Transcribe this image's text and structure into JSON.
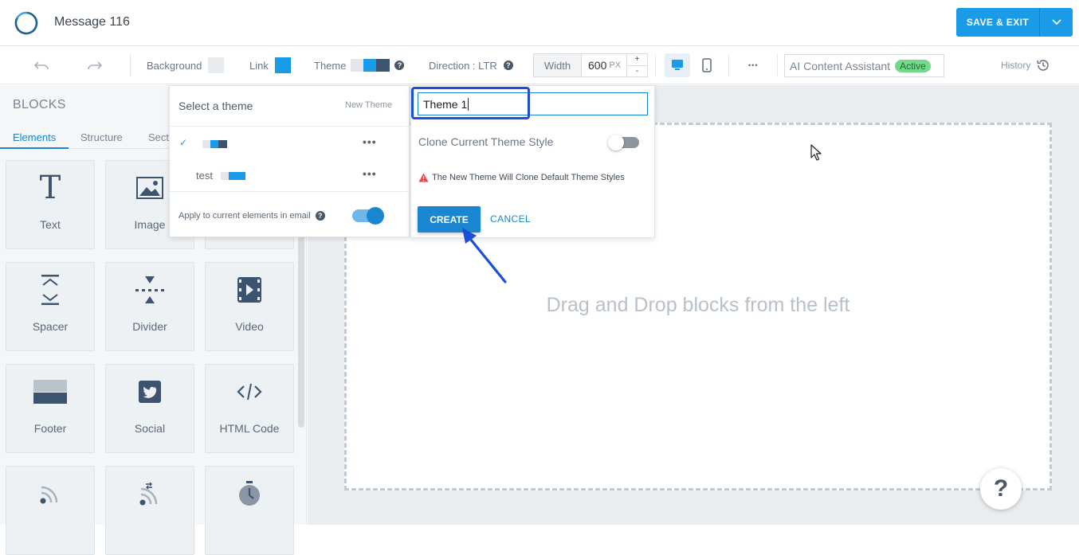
{
  "header": {
    "title": "Message 116",
    "save_label": "SAVE & EXIT"
  },
  "toolbar": {
    "background_label": "Background",
    "link_label": "Link",
    "theme_label": "Theme",
    "direction_label": "Direction : LTR",
    "width_label": "Width",
    "width_value": "600",
    "width_unit": "PX",
    "plus": "+",
    "minus": "-",
    "more": "•••",
    "ai_label": "AI Content Assistant",
    "ai_status": "Active",
    "history_label": "History",
    "help_glyph": "?",
    "background_color": "#e9ecef",
    "link_color": "#1a9be7"
  },
  "sidebar": {
    "title": "BLOCKS",
    "tabs": [
      "Elements",
      "Structure",
      "Sect"
    ],
    "tiles": [
      {
        "label": "Text",
        "icon": "text-icon"
      },
      {
        "label": "Image",
        "icon": "image-icon"
      },
      {
        "label": "Spacer",
        "icon": "spacer-icon"
      },
      {
        "label": "Divider",
        "icon": "divider-icon"
      },
      {
        "label": "Video",
        "icon": "video-icon"
      },
      {
        "label": "Footer",
        "icon": "footer-icon"
      },
      {
        "label": "Social",
        "icon": "twitter-icon"
      },
      {
        "label": "HTML Code",
        "icon": "code-icon"
      },
      {
        "label": "",
        "icon": "rss-icon"
      },
      {
        "label": "",
        "icon": "rss-refresh-icon"
      },
      {
        "label": "",
        "icon": "timer-icon"
      }
    ]
  },
  "theme_popover": {
    "title": "Select a theme",
    "new_theme": "New Theme",
    "themes": [
      {
        "name": "",
        "selected": true,
        "check": "✓"
      },
      {
        "name": "test",
        "selected": false,
        "check": ""
      }
    ],
    "row_menu": "•••",
    "apply_label": "Apply to current elements in email",
    "apply_enabled": true
  },
  "new_theme_popover": {
    "name_value": "Theme 1",
    "clone_label": "Clone Current Theme Style",
    "clone_enabled": false,
    "warning": "The New Theme Will Clone Default Theme Styles",
    "create_label": "CREATE",
    "cancel_label": "CANCEL"
  },
  "canvas": {
    "placeholder": "Drag and Drop blocks from the left",
    "help": "?"
  }
}
